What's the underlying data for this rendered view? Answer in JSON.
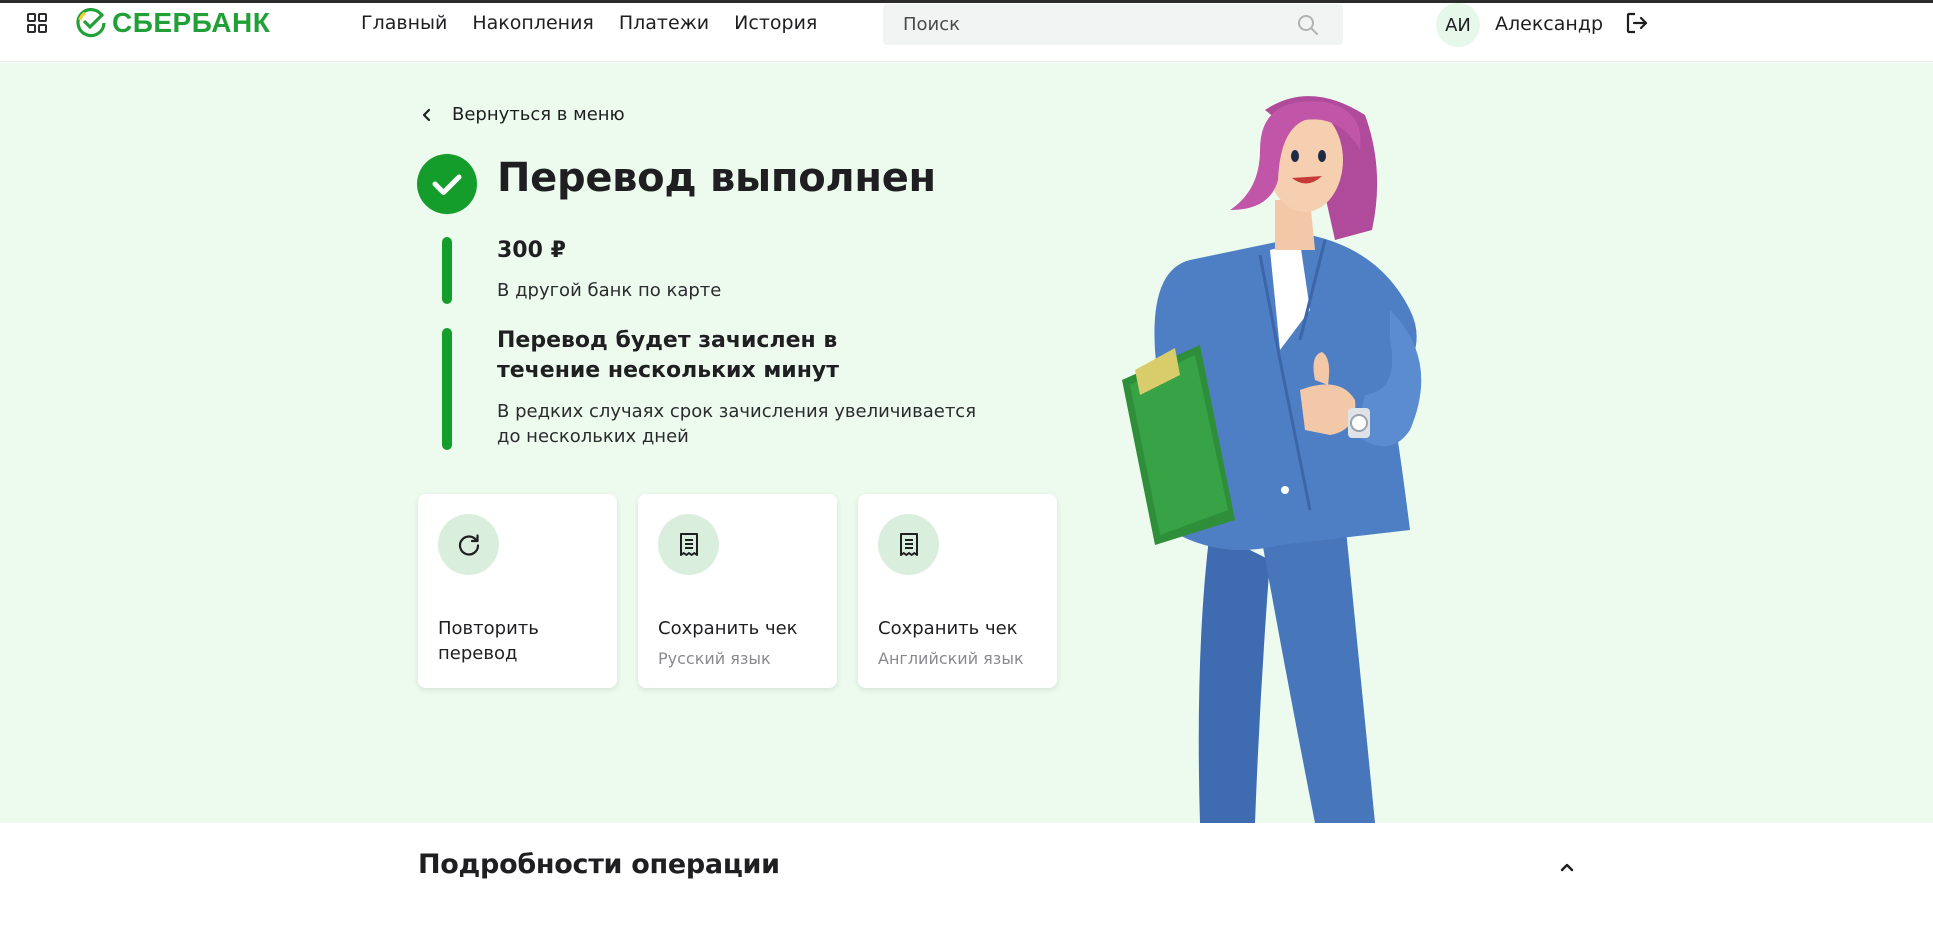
{
  "header": {
    "logo_text": "СБЕРБАНК",
    "nav": [
      "Главный",
      "Накопления",
      "Платежи",
      "История"
    ],
    "search_placeholder": "Поиск",
    "avatar_initials": "АИ",
    "user_name": "Александр"
  },
  "main": {
    "back_label": "Вернуться в меню",
    "title": "Перевод выполнен",
    "amount": "300 ₽",
    "amount_description": "В другой банк по карте",
    "notice_title": "Перевод будет зачислен в течение нескольких минут",
    "notice_text": "В редких случаях срок зачисления увеличивается до нескольких дней",
    "actions": [
      {
        "icon": "refresh-icon",
        "label_line1": "Повторить",
        "label_line2": "перевод",
        "sub": ""
      },
      {
        "icon": "receipt-icon",
        "label_line1": "Сохранить чек",
        "label_line2": "",
        "sub": "Русский язык"
      },
      {
        "icon": "receipt-icon",
        "label_line1": "Сохранить чек",
        "label_line2": "",
        "sub": "Английский язык"
      }
    ]
  },
  "details": {
    "title": "Подробности операции"
  },
  "colors": {
    "brand": "#21a038",
    "success": "#159d2b",
    "hero_bg": "#edfbef",
    "icon_bg": "#d9eedd"
  }
}
